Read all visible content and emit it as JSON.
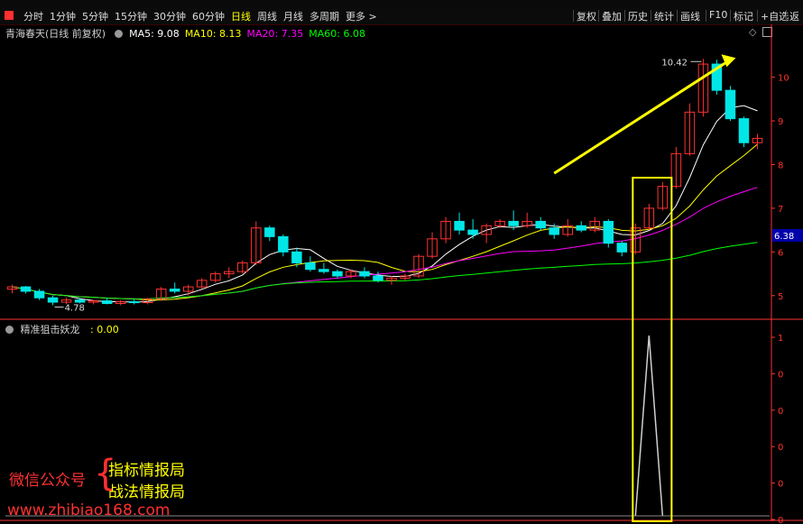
{
  "toolbar": {
    "periods": [
      "分时",
      "1分钟",
      "5分钟",
      "15分钟",
      "30分钟",
      "60分钟",
      "日线",
      "周线",
      "月线",
      "多周期"
    ],
    "active_period": "日线",
    "more": "更多 >",
    "right_items": [
      "复权",
      "叠加",
      "历史",
      "统计",
      "画线",
      "F10",
      "标记",
      "+自选",
      "返"
    ]
  },
  "main_pane": {
    "title": "青海春天(日线 前复权)",
    "ma": [
      {
        "label": "MA5: 9.08",
        "color": "#ffffff"
      },
      {
        "label": "MA10: 8.13",
        "color": "#ffff00"
      },
      {
        "label": "MA20: 7.35",
        "color": "#ff00ff"
      },
      {
        "label": "MA60: 6.08",
        "color": "#00ff00"
      }
    ],
    "high_label": "10.42",
    "low_label": "4.78",
    "price_tag": "6.38",
    "y_ticks": [
      "10",
      "9",
      "8",
      "7",
      "6",
      "5"
    ],
    "colors": {
      "up": "#ff3232",
      "down": "#00e6e6",
      "grid": "#3a0000",
      "axis": "#ff3232"
    }
  },
  "indicator_pane": {
    "title": "精准狙击妖龙",
    "value": ": 0.00",
    "y_ticks": [
      "1",
      "0",
      "0",
      "0",
      "0",
      "0"
    ]
  },
  "watermark": {
    "left": "微信公众号",
    "line1": "指标情报局",
    "line2": "战法情报局",
    "url": "www.zhibiao168.com"
  },
  "chart_data": {
    "type": "candlestick",
    "y_range": [
      4.5,
      10.9
    ],
    "candles": [
      [
        5.15,
        5.25,
        5.05,
        5.2
      ],
      [
        5.2,
        5.22,
        5.05,
        5.1
      ],
      [
        5.1,
        5.15,
        4.9,
        4.95
      ],
      [
        4.95,
        5.0,
        4.78,
        4.85
      ],
      [
        4.85,
        4.95,
        4.8,
        4.9
      ],
      [
        4.9,
        4.95,
        4.82,
        4.85
      ],
      [
        4.85,
        4.9,
        4.8,
        4.88
      ],
      [
        4.88,
        4.95,
        4.8,
        4.82
      ],
      [
        4.82,
        4.9,
        4.78,
        4.86
      ],
      [
        4.86,
        4.92,
        4.8,
        4.84
      ],
      [
        4.84,
        4.95,
        4.8,
        4.92
      ],
      [
        4.92,
        5.2,
        4.88,
        5.15
      ],
      [
        5.15,
        5.3,
        5.05,
        5.1
      ],
      [
        5.1,
        5.25,
        5.0,
        5.2
      ],
      [
        5.2,
        5.4,
        5.15,
        5.35
      ],
      [
        5.35,
        5.55,
        5.3,
        5.5
      ],
      [
        5.5,
        5.65,
        5.4,
        5.55
      ],
      [
        5.55,
        5.8,
        5.5,
        5.75
      ],
      [
        5.75,
        6.7,
        5.7,
        6.55
      ],
      [
        6.55,
        6.6,
        6.25,
        6.35
      ],
      [
        6.35,
        6.4,
        5.9,
        6.0
      ],
      [
        6.0,
        6.1,
        5.65,
        5.75
      ],
      [
        5.75,
        5.9,
        5.55,
        5.6
      ],
      [
        5.6,
        5.75,
        5.5,
        5.55
      ],
      [
        5.55,
        5.6,
        5.4,
        5.45
      ],
      [
        5.45,
        5.6,
        5.4,
        5.55
      ],
      [
        5.55,
        5.65,
        5.4,
        5.45
      ],
      [
        5.45,
        5.55,
        5.3,
        5.35
      ],
      [
        5.35,
        5.45,
        5.25,
        5.4
      ],
      [
        5.4,
        5.5,
        5.35,
        5.45
      ],
      [
        5.45,
        5.95,
        5.4,
        5.9
      ],
      [
        5.9,
        6.45,
        5.85,
        6.3
      ],
      [
        6.3,
        6.8,
        6.2,
        6.7
      ],
      [
        6.7,
        6.9,
        6.4,
        6.5
      ],
      [
        6.5,
        6.75,
        6.3,
        6.4
      ],
      [
        6.4,
        6.65,
        6.2,
        6.6
      ],
      [
        6.6,
        6.75,
        6.55,
        6.7
      ],
      [
        6.7,
        6.95,
        6.5,
        6.6
      ],
      [
        6.6,
        6.9,
        6.55,
        6.7
      ],
      [
        6.7,
        6.8,
        6.5,
        6.55
      ],
      [
        6.55,
        6.65,
        6.3,
        6.4
      ],
      [
        6.4,
        6.75,
        6.35,
        6.6
      ],
      [
        6.6,
        6.7,
        6.45,
        6.5
      ],
      [
        6.5,
        6.8,
        6.45,
        6.7
      ],
      [
        6.7,
        6.75,
        6.1,
        6.2
      ],
      [
        6.2,
        6.25,
        5.9,
        6.0
      ],
      [
        6.0,
        6.65,
        5.95,
        6.55
      ],
      [
        6.55,
        7.1,
        6.5,
        7.0
      ],
      [
        7.0,
        7.6,
        6.95,
        7.5
      ],
      [
        7.5,
        8.4,
        7.45,
        8.25
      ],
      [
        8.25,
        9.4,
        8.2,
        9.2
      ],
      [
        9.2,
        10.42,
        9.1,
        10.3
      ],
      [
        10.3,
        10.4,
        9.6,
        9.7
      ],
      [
        9.7,
        9.8,
        9.0,
        9.05
      ],
      [
        9.05,
        9.1,
        8.4,
        8.5
      ],
      [
        8.5,
        8.7,
        8.35,
        8.6
      ]
    ],
    "indicator": {
      "peak_index": 47,
      "value": 0
    }
  }
}
